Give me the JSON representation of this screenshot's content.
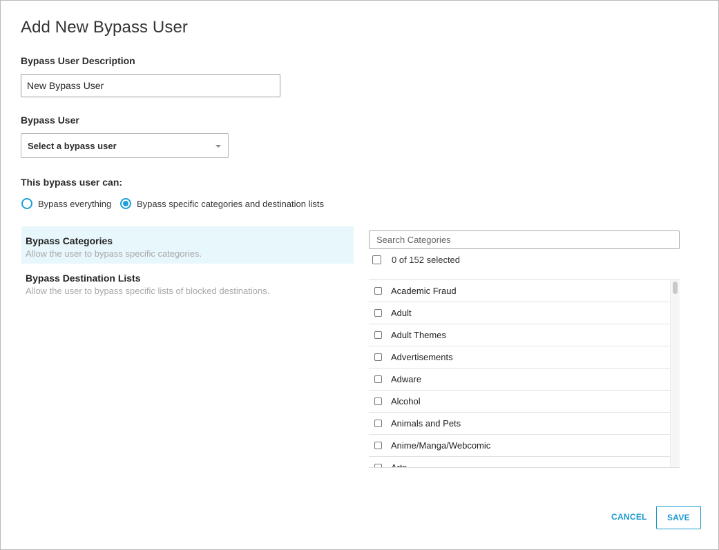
{
  "dialog": {
    "title": "Add New Bypass User"
  },
  "description": {
    "label": "Bypass User Description",
    "value": "New Bypass User"
  },
  "bypass_user": {
    "label": "Bypass User",
    "selected": "Select a bypass user"
  },
  "permissions": {
    "label": "This bypass user can:",
    "options": [
      {
        "label": "Bypass everything",
        "checked": false
      },
      {
        "label": "Bypass specific categories and destination lists",
        "checked": true
      }
    ]
  },
  "bypass_types": [
    {
      "title": "Bypass Categories",
      "subtitle": "Allow the user to bypass specific categories.",
      "active": true
    },
    {
      "title": "Bypass Destination Lists",
      "subtitle": "Allow the user to bypass specific lists of blocked destinations.",
      "active": false
    }
  ],
  "categories": {
    "search_placeholder": "Search Categories",
    "selected_text": "0 of 152 selected",
    "items": [
      "Academic Fraud",
      "Adult",
      "Adult Themes",
      "Advertisements",
      "Adware",
      "Alcohol",
      "Animals and Pets",
      "Anime/Manga/Webcomic",
      "Arts"
    ]
  },
  "actions": {
    "cancel_label": "CANCEL",
    "save_label": "SAVE"
  },
  "colors": {
    "accent": "#1ba0d7",
    "active_bg": "#e8f7fc"
  }
}
